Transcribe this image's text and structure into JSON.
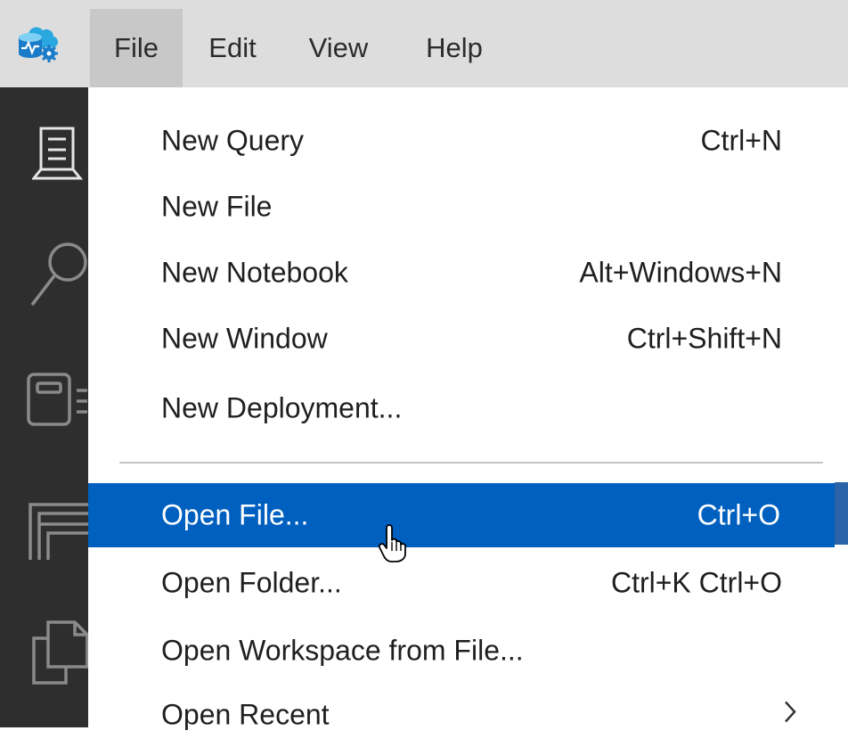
{
  "menubar": {
    "logo_icon": "azure-data-studio-logo-icon",
    "items": [
      {
        "label": "File",
        "active": true
      },
      {
        "label": "Edit",
        "active": false
      },
      {
        "label": "View",
        "active": false
      },
      {
        "label": "Help",
        "active": false
      }
    ]
  },
  "activity_bar": {
    "icons": [
      "servers-icon",
      "search-icon",
      "notebook-icon",
      "panels-icon",
      "copy-icon"
    ]
  },
  "file_menu": {
    "items": [
      {
        "label": "New Query",
        "shortcut": "Ctrl+N"
      },
      {
        "label": "New File",
        "shortcut": ""
      },
      {
        "label": "New Notebook",
        "shortcut": "Alt+Windows+N"
      },
      {
        "label": "New Window",
        "shortcut": "Ctrl+Shift+N"
      },
      {
        "label": "New Deployment...",
        "shortcut": ""
      },
      {
        "label": "Open File...",
        "shortcut": "Ctrl+O",
        "highlighted": true
      },
      {
        "label": "Open Folder...",
        "shortcut": "Ctrl+K Ctrl+O"
      },
      {
        "label": "Open Workspace from File...",
        "shortcut": ""
      },
      {
        "label": "Open Recent",
        "shortcut": "",
        "submenu": true
      }
    ]
  },
  "colors": {
    "menubar_bg": "#dddddd",
    "activity_bar_bg": "#2e2e2e",
    "highlight_bg": "#0060c0",
    "menu_text": "#1f1f1f"
  }
}
